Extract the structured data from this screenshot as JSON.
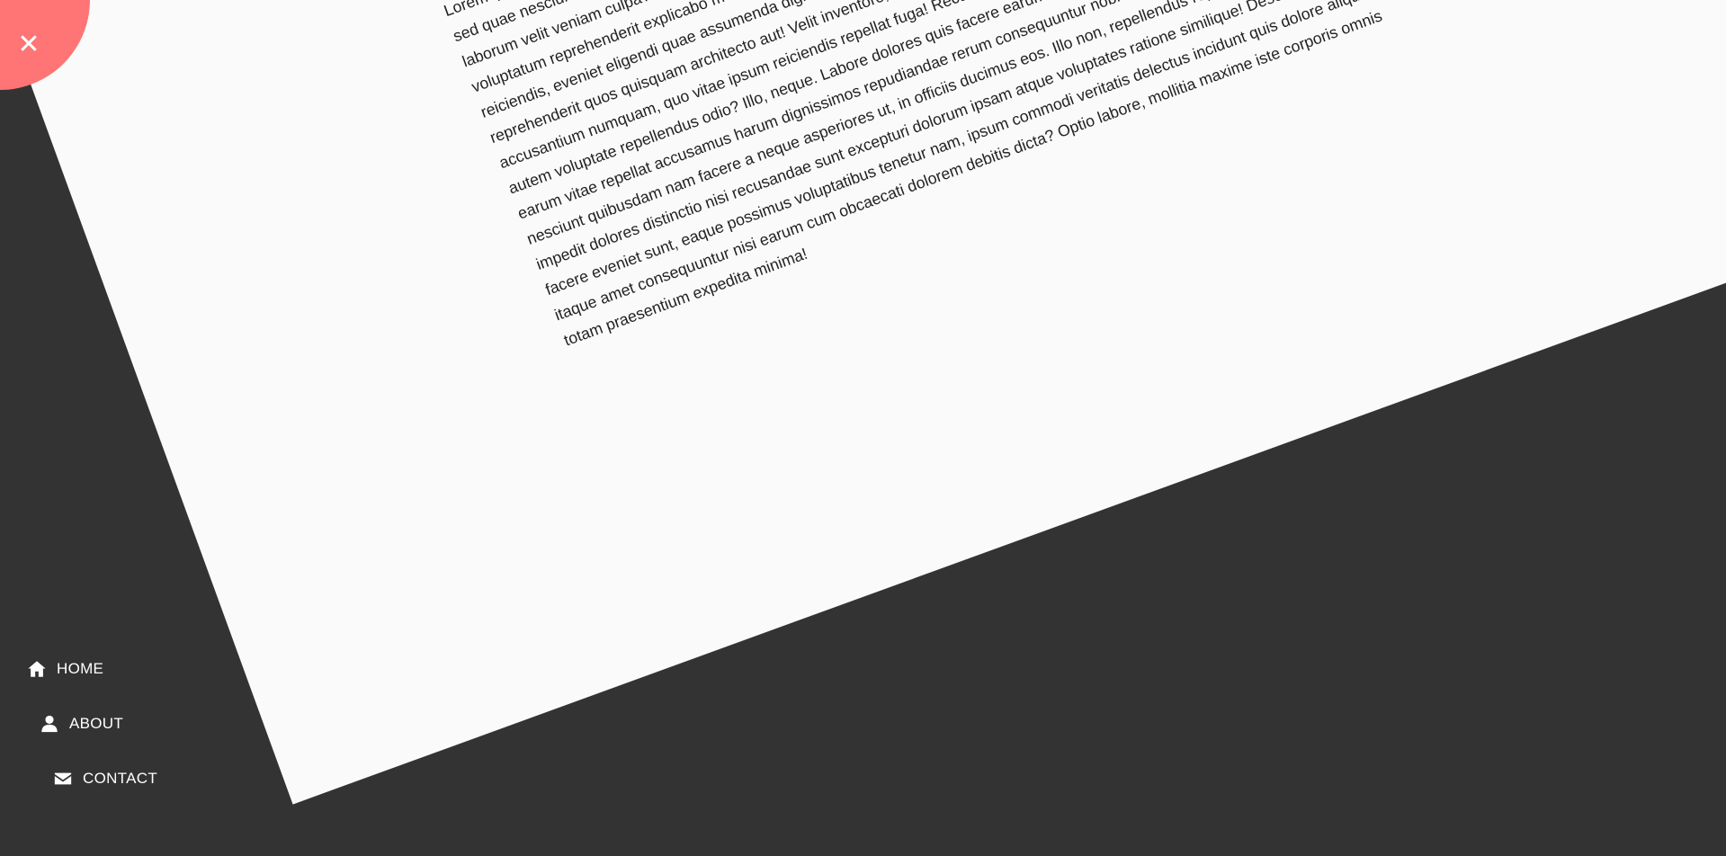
{
  "colors": {
    "background": "#333333",
    "sheet": "#fafafa",
    "text": "#222222",
    "close_button": "#ff7575",
    "nav_text": "#ffffff"
  },
  "close_button": {
    "icon": "close-icon",
    "glyph": "✕"
  },
  "article": {
    "title": "",
    "body": "Lorem ipsum dolor sit amet consectetur adipisicing elit. Culpa blanditiis, nobis accusamus quas reprehenderit nam temporibus, sed quae nesciunt provident nam ten voluptatem. Voluptatum saepe odit magnam molestiae unde repudiandae eligendi laborum velit veniam culpa? Soluta autem laboriosam ut voluptas rem velit laborum enim maxime commodi ex perspiciatis rem voluptatum reprehenderit explicabo molestiae fuga ex, debitis quis aut magnam, laboriosam ut voluptatum architecto, reiciendis, eveniet eligendi quae assumenda dignissimos repudiandae dolorum laborum, soluta cupiditate, corporis et reprehenderit quos quisquam architecto aut! Velit inventore, aut provident quasi voluptatum ipsam cum quis, eligendi accusantium numquam, quo vitae ipsum reiciendis repellat fuga! Recusandae libero dicta sequi perferendis. Qui iusto, fugit autem voluptate repellendus odio? Illo, neque. Labore dolores quis facere earum omnis quo? Quo voluptas molestiae et quis, earum vitae repellat accusamus harum dignissimos repudiandae rerum consequuntur nobis assumenda inventore. Error nesciunt quibusdam nam facere a neque asperiores ut, in officiis ducimus eos. Illo non, repellendus reprehenderit explicabo impedit dolores distinctio nisi recusandae sunt excepturi dolorum ipsam atque voluptates ratione similique! Deserunt natus, facere eveniet sunt, eaque possimus voluptatibus tenetur nam, ipsum commodi veritatis delectus incidunt quis dolore aliquam itaque amet consequuntur nisi earum cum obcaecati dolorem debitis dicta? Optio labore, mollitia maxime iste corporis omnis totam praesentium expedita minima!"
  },
  "nav": {
    "items": [
      {
        "label": "HOME",
        "icon": "home-icon"
      },
      {
        "label": "ABOUT",
        "icon": "user-icon"
      },
      {
        "label": "CONTACT",
        "icon": "envelope-icon"
      }
    ]
  }
}
